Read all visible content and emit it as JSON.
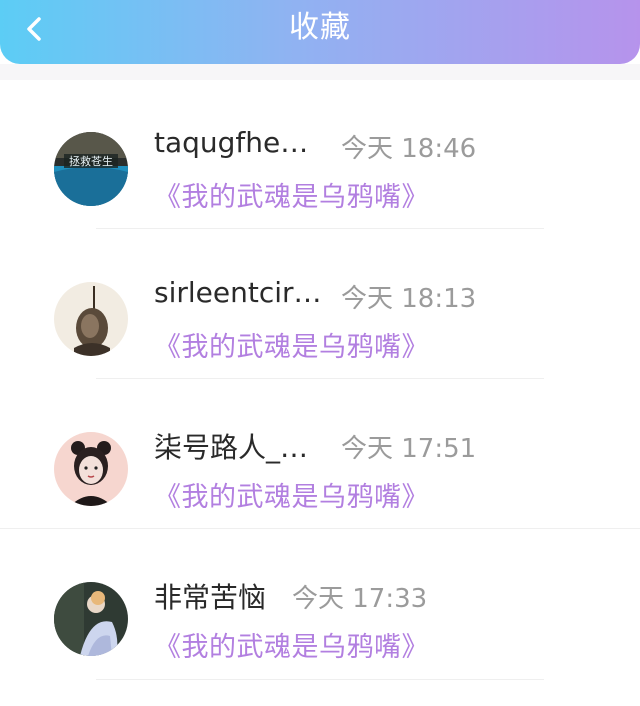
{
  "header": {
    "title": "收藏",
    "back_icon": "chevron-left-icon",
    "gradient": [
      "#5ccdf5",
      "#b693ec"
    ]
  },
  "favorites": [
    {
      "user": "taqugfhe…",
      "time": "今天 18:46",
      "book": "《我的武魂是乌鸦嘴》"
    },
    {
      "user": "sirleentcir…",
      "time": "今天 18:13",
      "book": "《我的武魂是乌鸦嘴》"
    },
    {
      "user": "柒号路人_…",
      "time": "今天 17:51",
      "book": "《我的武魂是乌鸦嘴》"
    },
    {
      "user": "非常苦恼",
      "time": "今天 17:33",
      "book": "《我的武魂是乌鸦嘴》"
    }
  ],
  "colors": {
    "book_title": "#b27fe0",
    "time": "#9b9b9b",
    "name": "#2a2a2a"
  }
}
